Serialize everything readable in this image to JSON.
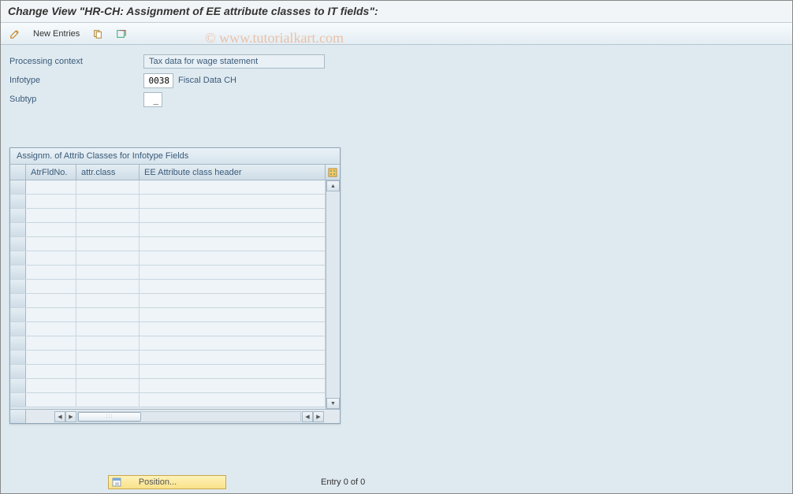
{
  "title": "Change View \"HR-CH: Assignment of EE attribute classes to IT fields\":",
  "toolbar": {
    "new_entries_label": "New Entries"
  },
  "form": {
    "processing_context_label": "Processing context",
    "processing_context_value": "Tax data for wage statement",
    "infotype_label": "Infotype",
    "infotype_value": "0038",
    "infotype_text": "Fiscal Data  CH",
    "subtyp_label": "Subtyp",
    "subtyp_value": "_"
  },
  "table": {
    "title": "Assignm. of Attrib Classes for Infotype Fields",
    "col1": "AtrFldNo.",
    "col2": "attr.class",
    "col3": "EE Attribute class header",
    "rows": [
      {
        "c1": "",
        "c2": "",
        "c3": ""
      },
      {
        "c1": "",
        "c2": "",
        "c3": ""
      },
      {
        "c1": "",
        "c2": "",
        "c3": ""
      },
      {
        "c1": "",
        "c2": "",
        "c3": ""
      },
      {
        "c1": "",
        "c2": "",
        "c3": ""
      },
      {
        "c1": "",
        "c2": "",
        "c3": ""
      },
      {
        "c1": "",
        "c2": "",
        "c3": ""
      },
      {
        "c1": "",
        "c2": "",
        "c3": ""
      },
      {
        "c1": "",
        "c2": "",
        "c3": ""
      },
      {
        "c1": "",
        "c2": "",
        "c3": ""
      },
      {
        "c1": "",
        "c2": "",
        "c3": ""
      },
      {
        "c1": "",
        "c2": "",
        "c3": ""
      },
      {
        "c1": "",
        "c2": "",
        "c3": ""
      },
      {
        "c1": "",
        "c2": "",
        "c3": ""
      },
      {
        "c1": "",
        "c2": "",
        "c3": ""
      },
      {
        "c1": "",
        "c2": "",
        "c3": ""
      }
    ]
  },
  "footer": {
    "position_label": "Position...",
    "entry_text": "Entry 0 of 0"
  },
  "watermark": "© www.tutorialkart.com"
}
